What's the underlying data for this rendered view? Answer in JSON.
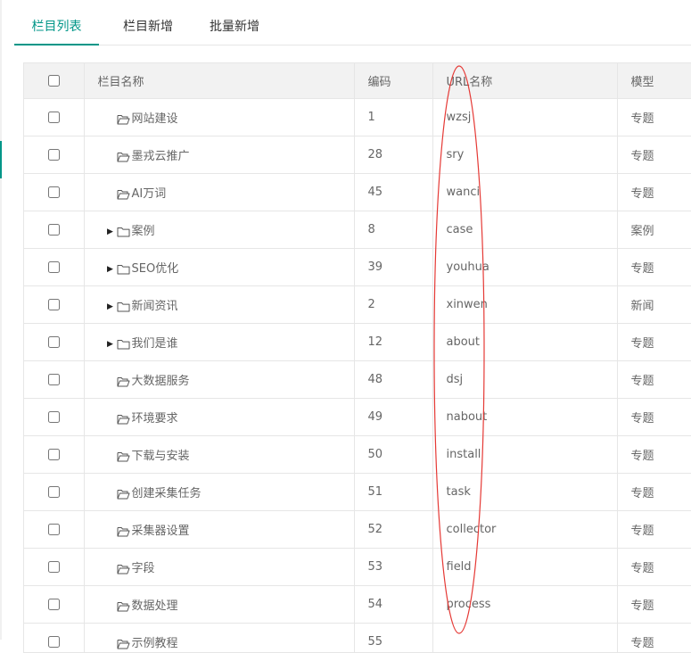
{
  "tabs": [
    {
      "label": "栏目列表",
      "active": true
    },
    {
      "label": "栏目新增",
      "active": false
    },
    {
      "label": "批量新增",
      "active": false
    }
  ],
  "table": {
    "headers": {
      "name": "栏目名称",
      "code": "编码",
      "url": "URL名称",
      "model": "模型"
    },
    "rows": [
      {
        "name": "网站建设",
        "code": "1",
        "url": "wzsj",
        "model": "专题",
        "expandable": false,
        "open": true
      },
      {
        "name": "墨戎云推广",
        "code": "28",
        "url": "sry",
        "model": "专题",
        "expandable": false,
        "open": true
      },
      {
        "name": "AI万词",
        "code": "45",
        "url": "wanci",
        "model": "专题",
        "expandable": false,
        "open": true
      },
      {
        "name": "案例",
        "code": "8",
        "url": "case",
        "model": "案例",
        "expandable": true,
        "open": false
      },
      {
        "name": "SEO优化",
        "code": "39",
        "url": "youhua",
        "model": "专题",
        "expandable": true,
        "open": false
      },
      {
        "name": "新闻资讯",
        "code": "2",
        "url": "xinwen",
        "model": "新闻",
        "expandable": true,
        "open": false
      },
      {
        "name": "我们是谁",
        "code": "12",
        "url": "about",
        "model": "专题",
        "expandable": true,
        "open": false
      },
      {
        "name": "大数据服务",
        "code": "48",
        "url": "dsj",
        "model": "专题",
        "expandable": false,
        "open": true
      },
      {
        "name": "环境要求",
        "code": "49",
        "url": "nabout",
        "model": "专题",
        "expandable": false,
        "open": true
      },
      {
        "name": "下载与安装",
        "code": "50",
        "url": "install",
        "model": "专题",
        "expandable": false,
        "open": true
      },
      {
        "name": "创建采集任务",
        "code": "51",
        "url": "task",
        "model": "专题",
        "expandable": false,
        "open": true
      },
      {
        "name": "采集器设置",
        "code": "52",
        "url": "collector",
        "model": "专题",
        "expandable": false,
        "open": true
      },
      {
        "name": "字段",
        "code": "53",
        "url": "field",
        "model": "专题",
        "expandable": false,
        "open": true
      },
      {
        "name": "数据处理",
        "code": "54",
        "url": "process",
        "model": "专题",
        "expandable": false,
        "open": true
      },
      {
        "name": "示例教程",
        "code": "55",
        "url": "",
        "model": "专题",
        "expandable": false,
        "open": true
      }
    ]
  },
  "colors": {
    "accent": "#009688",
    "annotation": "#e53935",
    "header_bg": "#f2f2f2",
    "border": "#e6e6e6"
  },
  "icons": {
    "expand": "caret-right-icon",
    "folder_open": "folder-open-icon",
    "folder_closed": "folder-icon"
  }
}
